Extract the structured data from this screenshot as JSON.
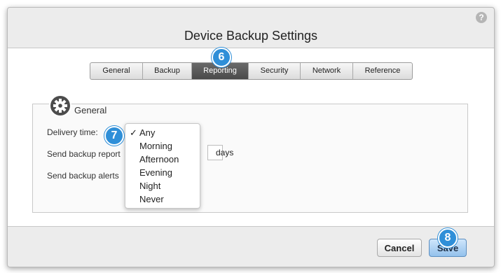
{
  "dialog": {
    "title": "Device Backup Settings",
    "help_glyph": "?"
  },
  "tabs": [
    {
      "label": "General"
    },
    {
      "label": "Backup"
    },
    {
      "label": "Reporting",
      "active": true
    },
    {
      "label": "Security"
    },
    {
      "label": "Network"
    },
    {
      "label": "Reference"
    }
  ],
  "badges": {
    "tabs": "6",
    "delivery": "7",
    "save": "8"
  },
  "group": {
    "title": "General",
    "icon": "gear-icon",
    "delivery_label": "Delivery time:",
    "report_label": "Send backup report",
    "report_unit": "days",
    "alerts_label": "Send backup alerts"
  },
  "delivery_dropdown": {
    "selected": "Any",
    "options": [
      "Any",
      "Morning",
      "Afternoon",
      "Evening",
      "Night",
      "Never"
    ]
  },
  "buttons": {
    "cancel": "Cancel",
    "save": "Save"
  },
  "colors": {
    "accent": "#2f8fd8",
    "active_tab": "#555555",
    "save_button": "#a9cff2"
  }
}
